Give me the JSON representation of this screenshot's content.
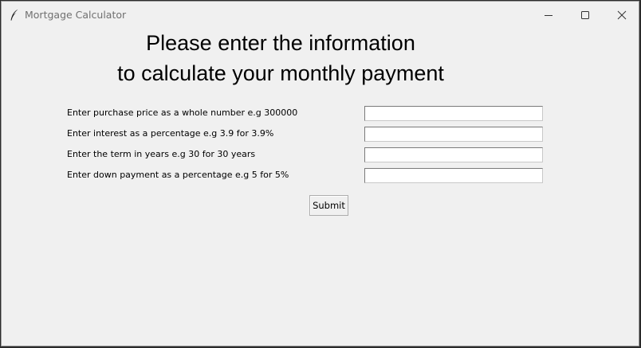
{
  "window": {
    "title": "Mortgage Calculator",
    "icon": "feather-icon"
  },
  "heading": {
    "line1": "Please enter the information",
    "line2": "to calculate your monthly payment"
  },
  "form": {
    "fields": [
      {
        "label": "Enter purchase price as a whole number  e.g 300000",
        "value": ""
      },
      {
        "label": "Enter interest as a percentage  e.g 3.9 for 3.9%",
        "value": ""
      },
      {
        "label": "Enter the term in years  e.g 30 for 30 years",
        "value": ""
      },
      {
        "label": "Enter down payment as a percentage e.g 5 for 5%",
        "value": ""
      }
    ],
    "submit_label": "Submit"
  }
}
